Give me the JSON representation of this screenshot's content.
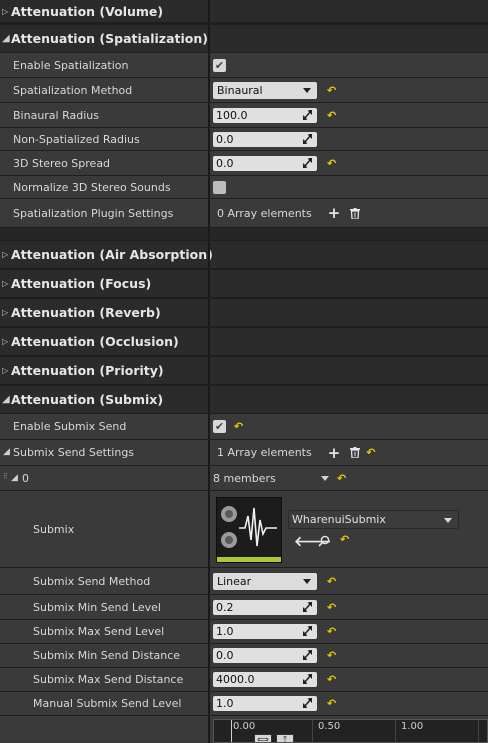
{
  "categories": {
    "volume": "Attenuation (Volume)",
    "spatialization": "Attenuation (Spatialization)",
    "air_absorption": "Attenuation (Air Absorption)",
    "focus": "Attenuation (Focus)",
    "reverb": "Attenuation (Reverb)",
    "occlusion": "Attenuation (Occlusion)",
    "priority": "Attenuation (Priority)",
    "submix": "Attenuation (Submix)"
  },
  "spatialization": {
    "enable_label": "Enable Spatialization",
    "enable_checked": true,
    "method_label": "Spatialization Method",
    "method_value": "Binaural",
    "binaural_radius_label": "Binaural Radius",
    "binaural_radius_value": "100.0",
    "non_spatialized_label": "Non-Spatialized Radius",
    "non_spatialized_value": "0.0",
    "stereo_spread_label": "3D Stereo Spread",
    "stereo_spread_value": "0.0",
    "normalize_label": "Normalize 3D Stereo Sounds",
    "normalize_checked": false,
    "plugin_label": "Spatialization Plugin Settings",
    "plugin_value": "0 Array elements"
  },
  "submix": {
    "enable_label": "Enable Submix Send",
    "enable_checked": true,
    "send_settings_label": "Submix Send Settings",
    "send_settings_value": "1 Array elements",
    "index_label": "0",
    "members_value": "8 members",
    "submix_label": "Submix",
    "submix_asset": "WharenuiSubmix",
    "method_label": "Submix Send Method",
    "method_value": "Linear",
    "min_send_level_label": "Submix Min Send Level",
    "min_send_level_value": "0.2",
    "max_send_level_label": "Submix Max Send Level",
    "max_send_level_value": "1.0",
    "min_send_distance_label": "Submix Min Send Distance",
    "min_send_distance_value": "0.0",
    "max_send_distance_label": "Submix Max Send Distance",
    "max_send_distance_value": "4000.0",
    "manual_level_label": "Manual Submix Send Level",
    "manual_level_value": "1.0",
    "curve_ticks": [
      "0.00",
      "0.50",
      "1.00"
    ]
  },
  "colors": {
    "reset_arrow": "#e0d000",
    "thumbnail_accent": "#a8c838"
  }
}
